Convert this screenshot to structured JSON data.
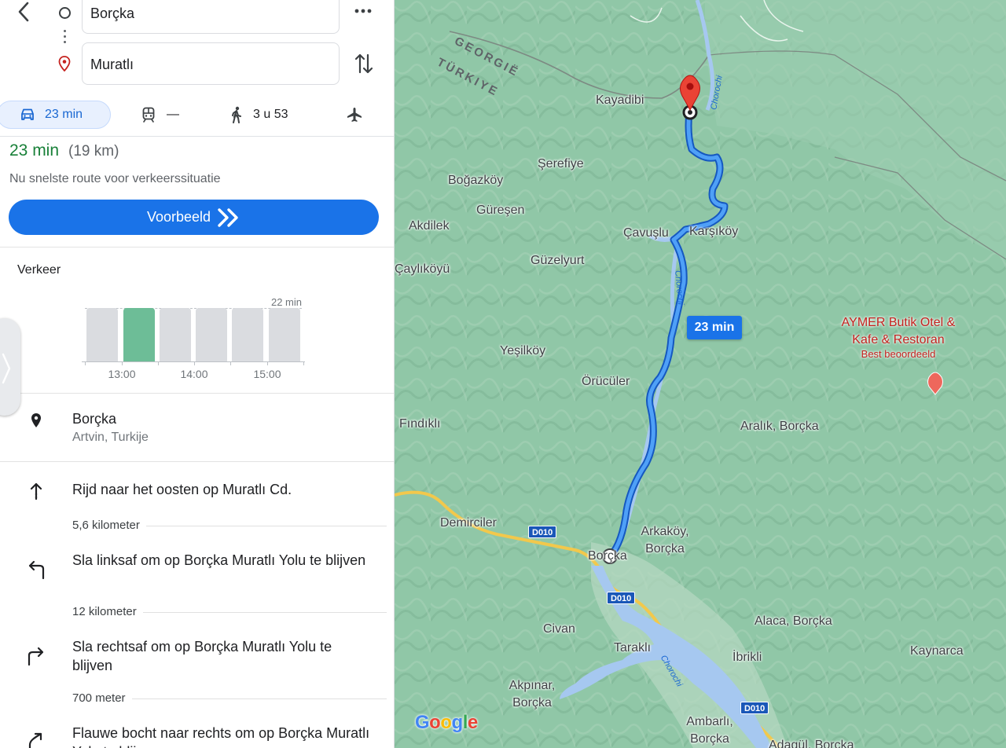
{
  "directions": {
    "origin_value": "Borçka",
    "destination_value": "Muratlı"
  },
  "modes": {
    "car": "23 min",
    "transit": "—",
    "walk": "3 u 53"
  },
  "summary": {
    "time": "23 min",
    "distance": "(19 km)",
    "subtitle": "Nu snelste route voor verkeerssituatie",
    "preview_label": "Voorbeeld"
  },
  "traffic": {
    "title": "Verkeer",
    "max_label": "22 min",
    "ticks": [
      "13:00",
      "14:00",
      "15:00"
    ],
    "active_index": 1
  },
  "start_place": {
    "name": "Borçka",
    "sub": "Artvin, Turkije"
  },
  "steps": [
    {
      "text": "Rijd naar het oosten op Muratlı Cd.",
      "distance": "5,6 kilometer",
      "icon": "straight-arrow-icon"
    },
    {
      "text": "Sla linksaf om op Borçka Muratlı Yolu te blijven",
      "distance": "12 kilometer",
      "icon": "turn-left-icon"
    },
    {
      "text": "Sla rechtsaf om op Borçka Muratlı Yolu te blijven",
      "distance": "700 meter",
      "icon": "turn-right-icon"
    },
    {
      "text": "Flauwe bocht naar rechts om op Borçka Muratlı Yolu te blijven",
      "icon": "slight-right-icon"
    }
  ],
  "map": {
    "eta_callout": "23 min",
    "border_labels": [
      "GEORGIË",
      "TÜRKIYE"
    ],
    "places": {
      "kayadibi": "Kayadibi",
      "serefiye": "Şerefiye",
      "bogazkoy": "Boğazköy",
      "guresen": "Güreşen",
      "akdilek": "Akdilek",
      "cavuslu": "Çavuşlu",
      "karsikoy": "Karşıköy",
      "guzelyurt": "Güzelyurt",
      "caylikoyu": "Çaylıköyü",
      "yesilkoy": "Yeşilköy",
      "orucular": "Örücüler",
      "findikli": "Fındıklı",
      "aralik": "Aralık, Borçka",
      "demirciler": "Demirciler",
      "arkakoy_1": "Arkaköy,",
      "arkakoy_2": "Borçka",
      "borcka": "Borçka",
      "civan": "Civan",
      "alaca": "Alaca, Borçka",
      "tarakli": "Taraklı",
      "ibrikli": "İbrikli",
      "kaynarca": "Kaynarca",
      "akpinar_1": "Akpınar,",
      "akpinar_2": "Borçka",
      "ambarli_1": "Ambarlı,",
      "ambarli_2": "Borçka",
      "adagul": "Adagül, Borçka"
    },
    "roads": [
      "D010",
      "D010",
      "D010"
    ],
    "rivers": [
      "Chorochi",
      "Chorochi",
      "Chorochi"
    ],
    "poi": {
      "name": "AYMER Butik Otel & Kafe & Restoran",
      "badge": "Best beoordeeld"
    },
    "attribution": "Google"
  }
}
